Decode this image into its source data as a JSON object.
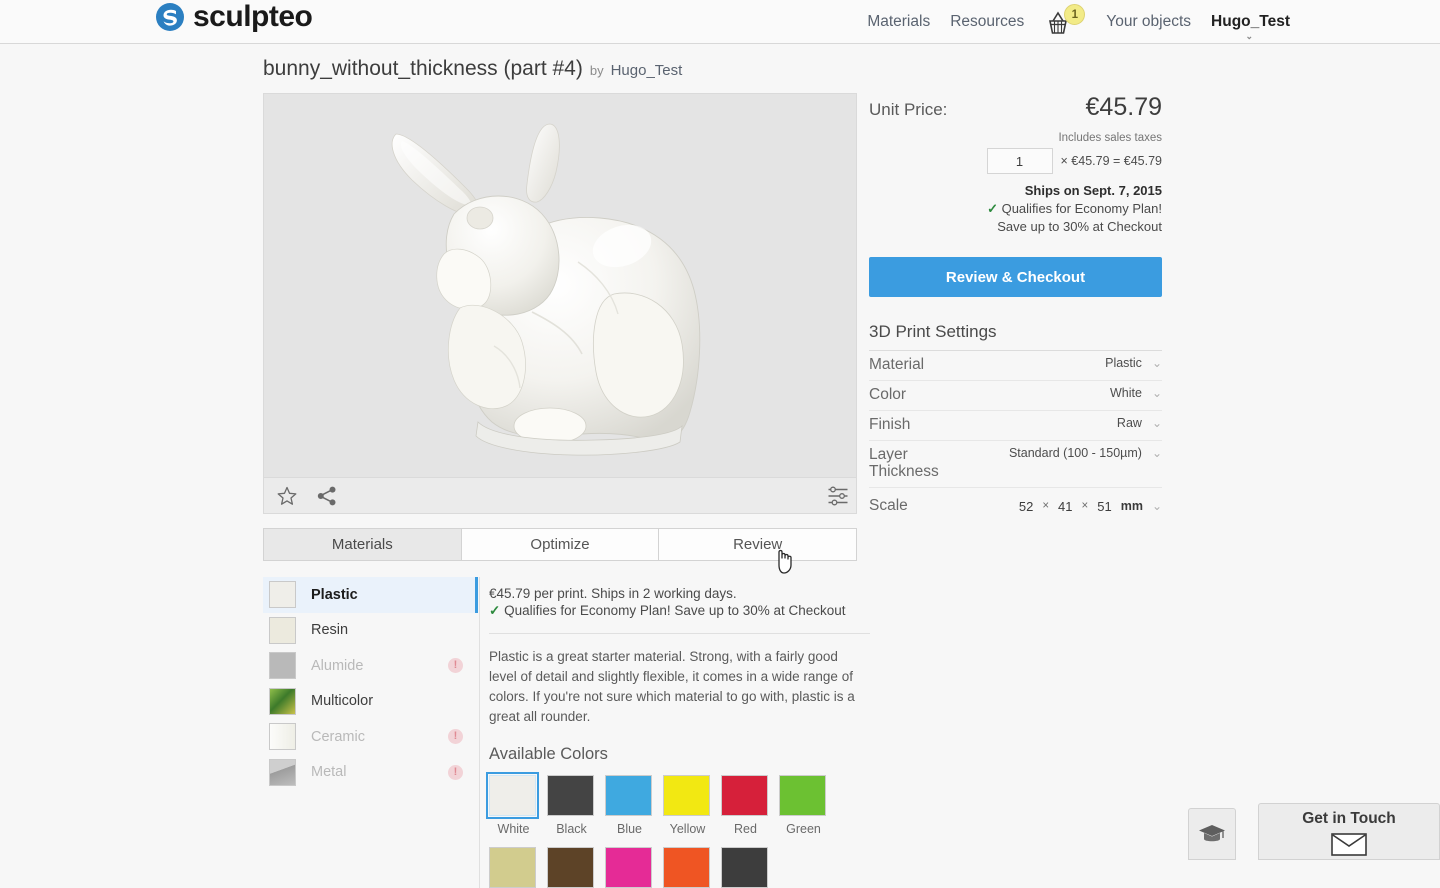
{
  "nav": {
    "brand": "sculpteo",
    "links": [
      {
        "label": "Materials",
        "name": "nav-materials"
      },
      {
        "label": "Resources",
        "name": "nav-resources"
      }
    ],
    "cart_icon": "basket-icon",
    "cart_count": "1",
    "your_objects": "Your objects",
    "user": "Hugo_Test"
  },
  "title": {
    "name": "bunny_without_thickness (part #4)",
    "by": "by",
    "author": "Hugo_Test"
  },
  "viewer": {
    "toolbar": {
      "favorite_icon": "star-icon",
      "share_icon": "share-icon",
      "settings_icon": "sliders-icon"
    }
  },
  "tabs": [
    {
      "label": "Materials",
      "active": true
    },
    {
      "label": "Optimize",
      "active": false
    },
    {
      "label": "Review",
      "active": false
    }
  ],
  "materials": [
    {
      "label": "Plastic",
      "selected": true,
      "disabled": false,
      "swatch": "#efeee9",
      "warn": false
    },
    {
      "label": "Resin",
      "selected": false,
      "disabled": false,
      "swatch": "#eceade",
      "warn": false
    },
    {
      "label": "Alumide",
      "selected": false,
      "disabled": true,
      "swatch": "#b9b9b9",
      "warn": true
    },
    {
      "label": "Multicolor",
      "selected": false,
      "disabled": false,
      "swatch": "#6fa040",
      "warn": false
    },
    {
      "label": "Ceramic",
      "selected": false,
      "disabled": true,
      "swatch": "#f4f4ee",
      "warn": true
    },
    {
      "label": "Metal",
      "selected": false,
      "disabled": true,
      "swatch": "#b4b4b4",
      "warn": true
    }
  ],
  "material_detail": {
    "price_line": "€45.79 per print. Ships in 2 working days.",
    "eco_mark": "✓",
    "eco_line": "Qualifies for Economy Plan! Save up to 30% at Checkout",
    "description": "Plastic is a great starter material. Strong, with a fairly good level of detail and slightly flexible, it comes in a wide range of colors. If you're not sure which material to go with, plastic is a great all rounder.",
    "colors_title": "Available Colors",
    "colors_row1": [
      {
        "label": "White",
        "hex": "#efeeea",
        "selected": true
      },
      {
        "label": "Black",
        "hex": "#444444",
        "selected": false
      },
      {
        "label": "Blue",
        "hex": "#3fa9e0",
        "selected": false
      },
      {
        "label": "Yellow",
        "hex": "#f2e812",
        "selected": false
      },
      {
        "label": "Red",
        "hex": "#d6203a",
        "selected": false
      },
      {
        "label": "Green",
        "hex": "#6cc132",
        "selected": false
      }
    ],
    "colors_row2": [
      {
        "label": "",
        "hex": "#d2cc8e",
        "selected": false
      },
      {
        "label": "",
        "hex": "#5d4327",
        "selected": false
      },
      {
        "label": "",
        "hex": "#e52b96",
        "selected": false
      },
      {
        "label": "",
        "hex": "#ef5523",
        "selected": false
      },
      {
        "label": "",
        "hex": "#3d3d3d",
        "selected": false
      }
    ]
  },
  "price_panel": {
    "unit_price_label": "Unit Price:",
    "unit_price_value": "€45.79",
    "tax_note": "Includes sales taxes",
    "quantity": "1",
    "qty_calc": "× €45.79 = €45.79",
    "ships_on": "Ships on Sept. 7, 2015",
    "eco_mark": "✓",
    "eco_line": "Qualifies for Economy Plan!",
    "save_line": "Save up to 30% at Checkout",
    "checkout_label": "Review & Checkout",
    "accent_color": "#3b9ce0"
  },
  "print_settings": {
    "title": "3D Print Settings",
    "rows": [
      {
        "label": "Material",
        "value": "Plastic"
      },
      {
        "label": "Color",
        "value": "White"
      },
      {
        "label": "Finish",
        "value": "Raw"
      },
      {
        "label": "Layer Thickness",
        "value": "Standard (100 - 150µm)"
      }
    ],
    "scale": {
      "label": "Scale",
      "x": "52",
      "y": "41",
      "z": "51",
      "sep": "×",
      "unit": "mm"
    }
  },
  "widgets": {
    "edu_icon": "graduation-cap-icon",
    "contact_label": "Get in Touch",
    "contact_icon": "envelope-icon"
  }
}
